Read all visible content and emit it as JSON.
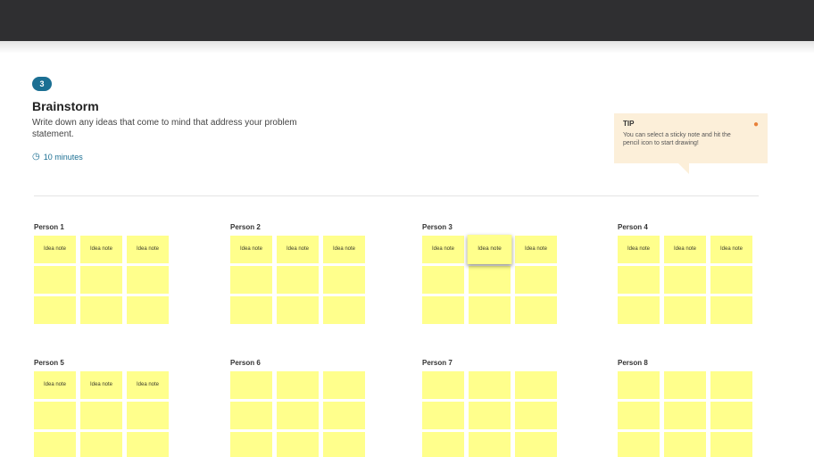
{
  "step": {
    "number": "3"
  },
  "section": {
    "title": "Brainstorm",
    "description": "Write down any ideas that come to mind that address your problem statement.",
    "timer": "10 minutes"
  },
  "tip": {
    "label": "TIP",
    "text": "You can select a sticky note and hit the pencil icon to start drawing!"
  },
  "people": [
    {
      "name": "Person 1",
      "notes": [
        "Idea note",
        "Idea note",
        "Idea note",
        "",
        "",
        "",
        "",
        "",
        ""
      ]
    },
    {
      "name": "Person 2",
      "notes": [
        "Idea note",
        "Idea note",
        "Idea note",
        "",
        "",
        "",
        "",
        "",
        ""
      ]
    },
    {
      "name": "Person 3",
      "notes": [
        "Idea note",
        "Idea note",
        "Idea note",
        "",
        "",
        "",
        "",
        "",
        ""
      ]
    },
    {
      "name": "Person 4",
      "notes": [
        "Idea note",
        "Idea note",
        "Idea note",
        "",
        "",
        "",
        "",
        "",
        ""
      ]
    },
    {
      "name": "Person 5",
      "notes": [
        "Idea note",
        "Idea note",
        "Idea note",
        "",
        "",
        "",
        "",
        "",
        ""
      ]
    },
    {
      "name": "Person 6",
      "notes": [
        "",
        "",
        "",
        "",
        "",
        "",
        "",
        "",
        ""
      ]
    },
    {
      "name": "Person 7",
      "notes": [
        "",
        "",
        "",
        "",
        "",
        "",
        "",
        "",
        ""
      ]
    },
    {
      "name": "Person 8",
      "notes": [
        "",
        "",
        "",
        "",
        "",
        "",
        "",
        "",
        ""
      ]
    }
  ],
  "colors": {
    "topbar": "#2f2f31",
    "accent": "#1b6f93",
    "sticky": "#ffff8c",
    "tip_bg": "#fcefd9"
  }
}
